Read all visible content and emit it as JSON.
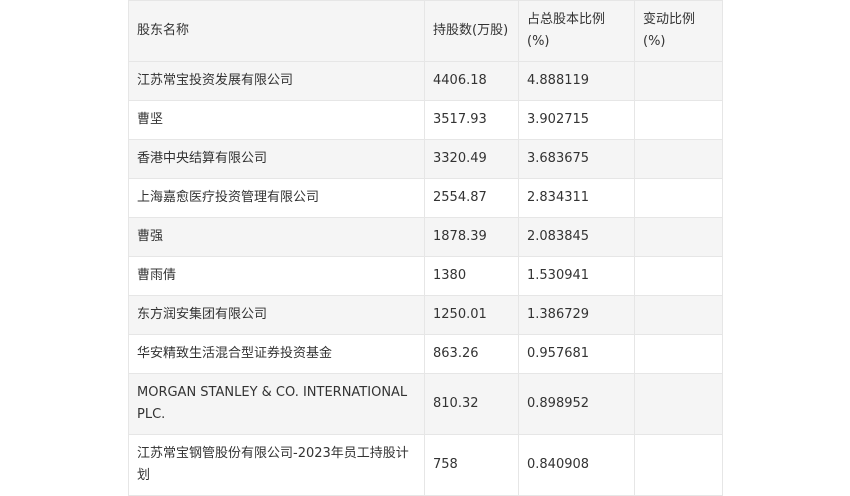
{
  "table": {
    "headers": [
      "股东名称",
      "持股数(万股)",
      "占总股本比例(%)",
      "变动比例(%)"
    ],
    "rows": [
      [
        "江苏常宝投资发展有限公司",
        "4406.18",
        "4.888119",
        ""
      ],
      [
        "曹坚",
        "3517.93",
        "3.902715",
        ""
      ],
      [
        "香港中央结算有限公司",
        "3320.49",
        "3.683675",
        ""
      ],
      [
        "上海嘉愈医疗投资管理有限公司",
        "2554.87",
        "2.834311",
        ""
      ],
      [
        "曹强",
        "1878.39",
        "2.083845",
        ""
      ],
      [
        "曹雨倩",
        "1380",
        "1.530941",
        ""
      ],
      [
        "东方润安集团有限公司",
        "1250.01",
        "1.386729",
        ""
      ],
      [
        "华安精致生活混合型证券投资基金",
        "863.26",
        "0.957681",
        ""
      ],
      [
        "MORGAN STANLEY & CO. INTERNATIONAL PLC.",
        "810.32",
        "0.898952",
        ""
      ],
      [
        "江苏常宝钢管股份有限公司-2023年员工持股计划",
        "758",
        "0.840908",
        ""
      ]
    ]
  }
}
